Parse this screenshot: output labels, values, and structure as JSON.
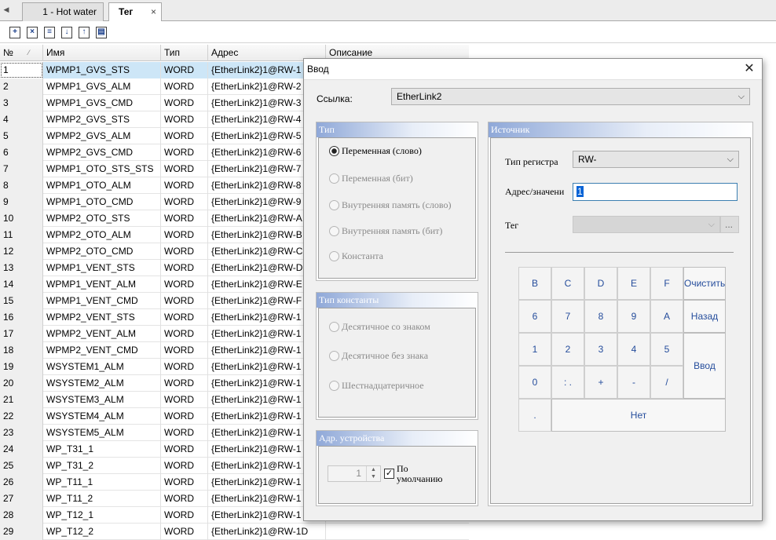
{
  "tabs": [
    {
      "label": "1 - Hot water"
    },
    {
      "label": "Тег",
      "close": "×"
    }
  ],
  "tab_scroll_glyph": "◀",
  "toolbar": {
    "icons": [
      "add-row-icon",
      "delete-row-icon",
      "insert-row-icon",
      "import-icon",
      "export-icon",
      "settings-icon"
    ],
    "glyphs": [
      "+",
      "×",
      "≡",
      "↓",
      "↑",
      "▤"
    ]
  },
  "table": {
    "columns": [
      "№",
      "Имя",
      "Тип",
      "Адрес",
      "Описание"
    ],
    "sort_glyph": "⁄",
    "rows": [
      {
        "n": "1",
        "name": "WPMP1_GVS_STS",
        "type": "WORD",
        "addr": "{EtherLink2}1@RW-1"
      },
      {
        "n": "2",
        "name": "WPMP1_GVS_ALM",
        "type": "WORD",
        "addr": "{EtherLink2}1@RW-2"
      },
      {
        "n": "3",
        "name": "WPMP1_GVS_CMD",
        "type": "WORD",
        "addr": "{EtherLink2}1@RW-3"
      },
      {
        "n": "4",
        "name": "WPMP2_GVS_STS",
        "type": "WORD",
        "addr": "{EtherLink2}1@RW-4"
      },
      {
        "n": "5",
        "name": "WPMP2_GVS_ALM",
        "type": "WORD",
        "addr": "{EtherLink2}1@RW-5"
      },
      {
        "n": "6",
        "name": "WPMP2_GVS_CMD",
        "type": "WORD",
        "addr": "{EtherLink2}1@RW-6"
      },
      {
        "n": "7",
        "name": "WPMP1_OTO_STS_STS",
        "type": "WORD",
        "addr": "{EtherLink2}1@RW-7"
      },
      {
        "n": "8",
        "name": "WPMP1_OTO_ALM",
        "type": "WORD",
        "addr": "{EtherLink2}1@RW-8"
      },
      {
        "n": "9",
        "name": "WPMP1_OTO_CMD",
        "type": "WORD",
        "addr": "{EtherLink2}1@RW-9"
      },
      {
        "n": "10",
        "name": "WPMP2_OTO_STS",
        "type": "WORD",
        "addr": "{EtherLink2}1@RW-A"
      },
      {
        "n": "11",
        "name": "WPMP2_OTO_ALM",
        "type": "WORD",
        "addr": "{EtherLink2}1@RW-B"
      },
      {
        "n": "12",
        "name": "WPMP2_OTO_CMD",
        "type": "WORD",
        "addr": "{EtherLink2}1@RW-C"
      },
      {
        "n": "13",
        "name": "WPMP1_VENT_STS",
        "type": "WORD",
        "addr": "{EtherLink2}1@RW-D"
      },
      {
        "n": "14",
        "name": "WPMP1_VENT_ALM",
        "type": "WORD",
        "addr": "{EtherLink2}1@RW-E"
      },
      {
        "n": "15",
        "name": "WPMP1_VENT_CMD",
        "type": "WORD",
        "addr": "{EtherLink2}1@RW-F"
      },
      {
        "n": "16",
        "name": "WPMP2_VENT_STS",
        "type": "WORD",
        "addr": "{EtherLink2}1@RW-1"
      },
      {
        "n": "17",
        "name": "WPMP2_VENT_ALM",
        "type": "WORD",
        "addr": "{EtherLink2}1@RW-1"
      },
      {
        "n": "18",
        "name": "WPMP2_VENT_CMD",
        "type": "WORD",
        "addr": "{EtherLink2}1@RW-1"
      },
      {
        "n": "19",
        "name": "WSYSTEM1_ALM",
        "type": "WORD",
        "addr": "{EtherLink2}1@RW-1"
      },
      {
        "n": "20",
        "name": "WSYSTEM2_ALM",
        "type": "WORD",
        "addr": "{EtherLink2}1@RW-1"
      },
      {
        "n": "21",
        "name": "WSYSTEM3_ALM",
        "type": "WORD",
        "addr": "{EtherLink2}1@RW-1"
      },
      {
        "n": "22",
        "name": "WSYSTEM4_ALM",
        "type": "WORD",
        "addr": "{EtherLink2}1@RW-1"
      },
      {
        "n": "23",
        "name": "WSYSTEM5_ALM",
        "type": "WORD",
        "addr": "{EtherLink2}1@RW-1"
      },
      {
        "n": "24",
        "name": "WP_T31_1",
        "type": "WORD",
        "addr": "{EtherLink2}1@RW-1"
      },
      {
        "n": "25",
        "name": "WP_T31_2",
        "type": "WORD",
        "addr": "{EtherLink2}1@RW-1"
      },
      {
        "n": "26",
        "name": "WP_T11_1",
        "type": "WORD",
        "addr": "{EtherLink2}1@RW-1"
      },
      {
        "n": "27",
        "name": "WP_T11_2",
        "type": "WORD",
        "addr": "{EtherLink2}1@RW-1"
      },
      {
        "n": "28",
        "name": "WP_T12_1",
        "type": "WORD",
        "addr": "{EtherLink2}1@RW-1"
      },
      {
        "n": "29",
        "name": "WP_T12_2",
        "type": "WORD",
        "addr": "{EtherLink2}1@RW-1D"
      }
    ]
  },
  "dialog": {
    "title": "Ввод",
    "close": "✕",
    "link_label": "Ссылка:",
    "link_value": "EtherLink2",
    "combo_arrow": "⌵",
    "type_group": {
      "title": "Тип",
      "options": [
        "Переменная (слово)",
        "Переменная (бит)",
        "Внутренняя память (слово)",
        "Внутренняя память (бит)",
        "Константа"
      ],
      "selected": 0
    },
    "const_group": {
      "title": "Тип константы",
      "options": [
        "Десятичное со знаком",
        "Десятичное без знака",
        "Шестнадцатеричное"
      ]
    },
    "device_group": {
      "title": "Адр. устройства",
      "value": "1",
      "spin_glyphs": [
        "▲",
        "▼"
      ],
      "default_label_1": "По",
      "default_label_2": "умолчанию",
      "checkmark": "✓"
    },
    "source_group": {
      "title": "Источник",
      "register_label": "Тип регистра",
      "register_value": "RW-",
      "address_label": "Адрес/значени",
      "address_value": "1",
      "tag_label": "Тег",
      "tag_button": "..."
    },
    "keypad": {
      "row1": [
        "B",
        "C",
        "D",
        "E",
        "F"
      ],
      "row2": [
        "6",
        "7",
        "8",
        "9",
        "A"
      ],
      "row3": [
        "1",
        "2",
        "3",
        "4",
        "5"
      ],
      "row4": [
        "0",
        ": .",
        "+",
        "-",
        "/"
      ],
      "dot": ".",
      "clear": "Очистить",
      "back": "Назад",
      "enter": "Ввод",
      "cancel": "Нет"
    }
  }
}
